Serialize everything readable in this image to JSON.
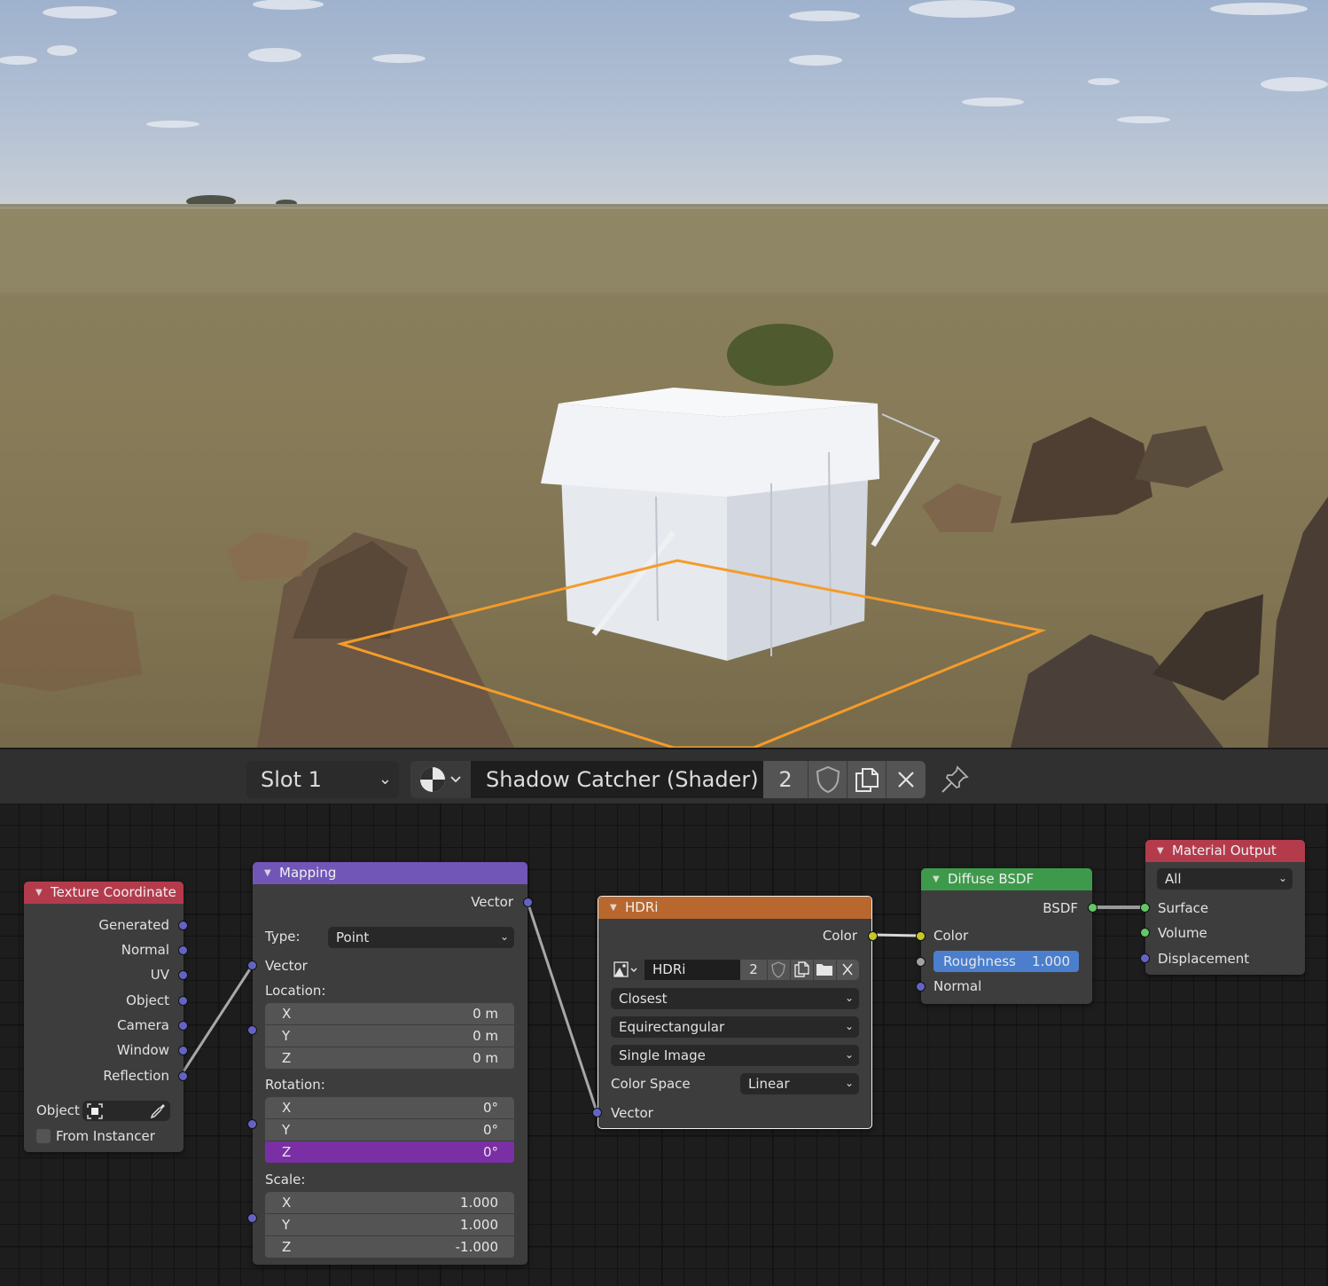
{
  "viewport": {
    "selection_outline_color": "#f59b2a",
    "sky_color": "#b5c2d4",
    "ground_color": "#8a7e5b"
  },
  "header": {
    "slot": "Slot 1",
    "browse_icon": "material-sphere-icon",
    "material_name": "Shadow Catcher (Shader)",
    "user_count": "2",
    "fake_user_icon": "shield-icon",
    "new_icon": "duplicate-icon",
    "unlink_icon": "close-icon",
    "pin_icon": "pin-icon"
  },
  "nodes": {
    "texture_coordinate": {
      "title": "Texture Coordinate",
      "outputs": [
        "Generated",
        "Normal",
        "UV",
        "Object",
        "Camera",
        "Window",
        "Reflection"
      ],
      "object_label": "Object",
      "from_instancer": "From Instancer",
      "from_instancer_checked": false,
      "color": "#b43b4c"
    },
    "mapping": {
      "title": "Mapping",
      "output": "Vector",
      "type_label": "Type:",
      "type_value": "Point",
      "input_vector": "Vector",
      "location_label": "Location:",
      "location": [
        {
          "axis": "X",
          "value": "0 m"
        },
        {
          "axis": "Y",
          "value": "0 m"
        },
        {
          "axis": "Z",
          "value": "0 m"
        }
      ],
      "rotation_label": "Rotation:",
      "rotation": [
        {
          "axis": "X",
          "value": "0°"
        },
        {
          "axis": "Y",
          "value": "0°"
        },
        {
          "axis": "Z",
          "value": "0°"
        }
      ],
      "scale_label": "Scale:",
      "scale": [
        {
          "axis": "X",
          "value": "1.000"
        },
        {
          "axis": "Y",
          "value": "1.000"
        },
        {
          "axis": "Z",
          "value": "-1.000"
        }
      ],
      "color": "#7156b8"
    },
    "hdri": {
      "title": "HDRi",
      "output": "Color",
      "image_name": "HDRi",
      "image_users": "2",
      "interpolation": "Closest",
      "projection": "Equirectangular",
      "source": "Single Image",
      "color_space_label": "Color Space",
      "color_space": "Linear",
      "input_vector": "Vector",
      "color": "#b8672f"
    },
    "diffuse": {
      "title": "Diffuse BSDF",
      "output": "BSDF",
      "input_color": "Color",
      "roughness_label": "Roughness",
      "roughness_value": "1.000",
      "input_normal": "Normal",
      "color": "#3e9a4b"
    },
    "material_output": {
      "title": "Material Output",
      "target": "All",
      "inputs": [
        "Surface",
        "Volume",
        "Displacement"
      ],
      "color": "#b43b4c"
    }
  }
}
